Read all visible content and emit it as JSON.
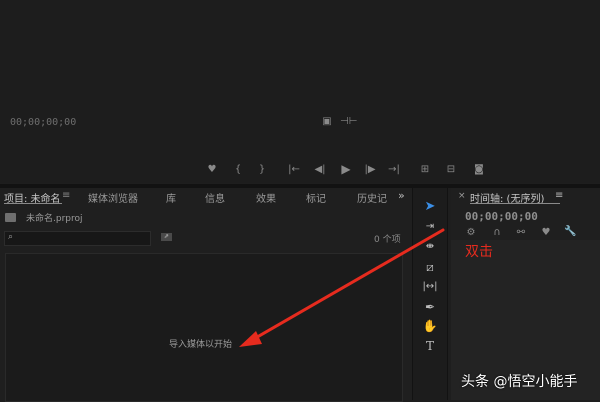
{
  "program_monitor": {
    "timecode": "00;00;00;00"
  },
  "project_panel": {
    "tabs": [
      {
        "label": "项目: 未命名"
      },
      {
        "label": "媒体浏览器"
      },
      {
        "label": "库"
      },
      {
        "label": "信息"
      },
      {
        "label": "效果"
      },
      {
        "label": "标记"
      },
      {
        "label": "历史记"
      }
    ],
    "project_file": "未命名.prproj",
    "search_placeholder": "",
    "item_count": "0 个项",
    "empty_hint": "导入媒体以开始"
  },
  "timeline_panel": {
    "title": "时间轴: (无序列)",
    "timecode": "00;00;00;00"
  },
  "annotation": {
    "label": "双击",
    "color": "#e62b1e"
  },
  "watermark": {
    "text": "头条 @悟空小能手"
  }
}
